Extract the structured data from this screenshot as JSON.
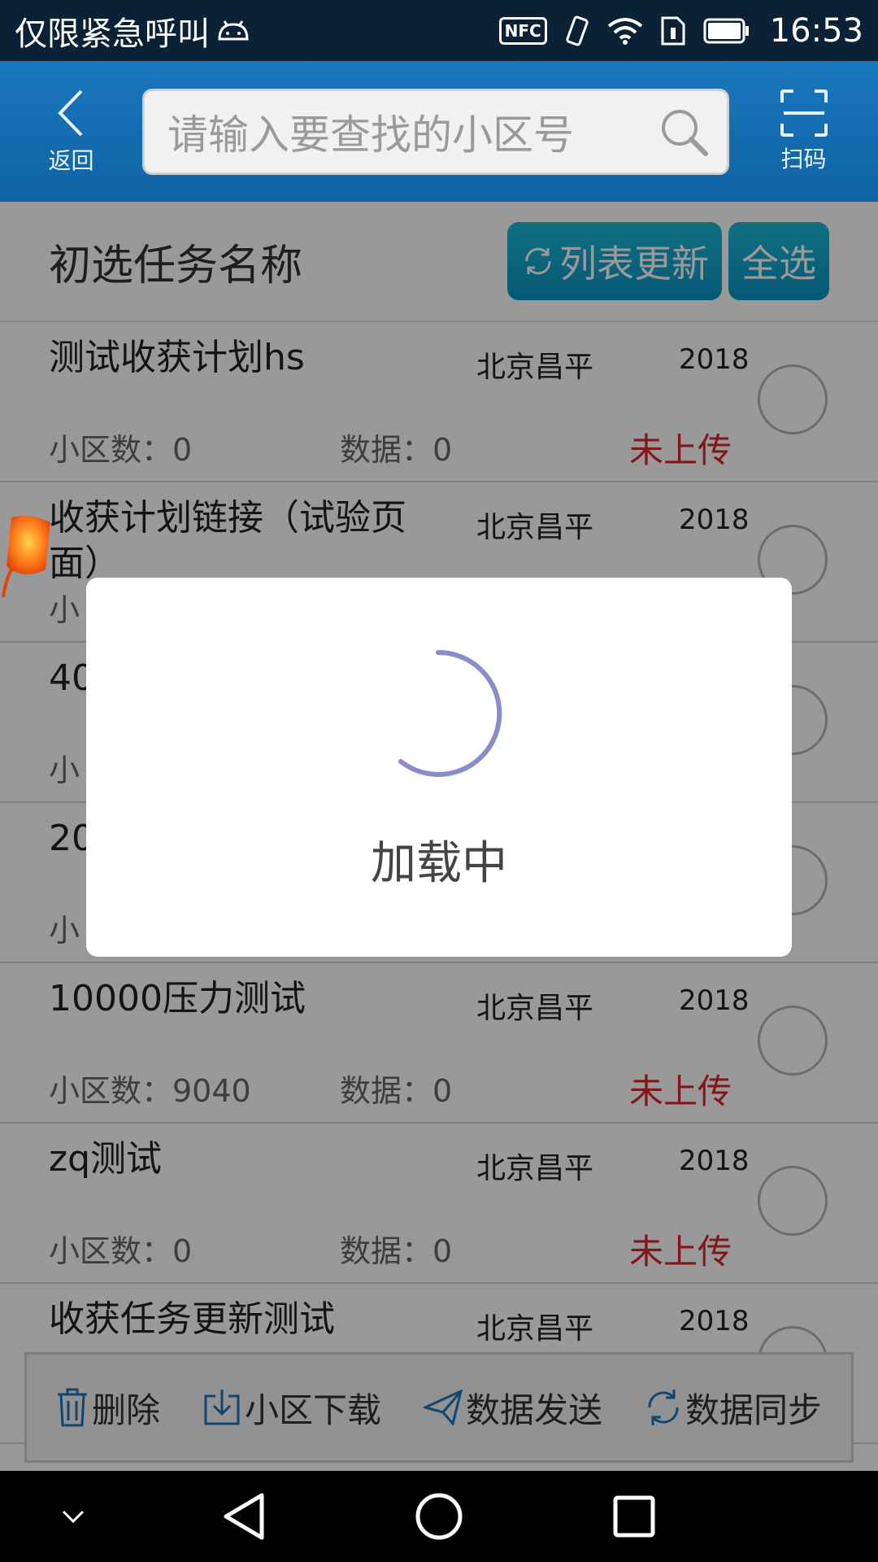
{
  "status_bar": {
    "carrier": "仅限紧急呼叫",
    "nfc": "NFC",
    "time": "16:53"
  },
  "header": {
    "back_label": "返回",
    "search_placeholder": "请输入要查找的小区号",
    "scan_label": "扫码"
  },
  "section": {
    "title": "初选任务名称",
    "refresh_label": "列表更新",
    "select_all_label": "全选"
  },
  "tasks": [
    {
      "name": "测试收获计划hs",
      "region": "北京昌平",
      "year": "2018",
      "cells": "小区数：0",
      "data": "数据：0",
      "status": "未上传"
    },
    {
      "name": "收获计划链接（试验页面）",
      "region": "北京昌平",
      "year": "2018",
      "cells": "小",
      "data": "",
      "status": ""
    },
    {
      "name": "40",
      "region": "",
      "year": "",
      "cells": "小",
      "data": "",
      "status": ""
    },
    {
      "name": "20",
      "region": "",
      "year": "",
      "cells": "小",
      "data": "",
      "status": ""
    },
    {
      "name": "10000压力测试",
      "region": "北京昌平",
      "year": "2018",
      "cells": "小区数：9040",
      "data": "数据：0",
      "status": "未上传"
    },
    {
      "name": "zq测试",
      "region": "北京昌平",
      "year": "2018",
      "cells": "小区数：0",
      "data": "数据：0",
      "status": "未上传"
    },
    {
      "name": "收获任务更新测试",
      "region": "北京昌平",
      "year": "2018",
      "cells": "",
      "data": "",
      "status": ""
    }
  ],
  "toolbar": {
    "delete": "删除",
    "download": "小区下载",
    "send": "数据发送",
    "sync": "数据同步"
  },
  "dialog": {
    "text": "加载中"
  },
  "colors": {
    "header": "#1a77bd",
    "accent_button": "#0c94c3",
    "status_red": "#d9252a",
    "spinner": "#8b8ccb"
  },
  "icons": [
    "back-icon",
    "search-icon",
    "scan-icon",
    "refresh-icon",
    "trash-icon",
    "download-icon",
    "send-icon",
    "sync-icon"
  ]
}
